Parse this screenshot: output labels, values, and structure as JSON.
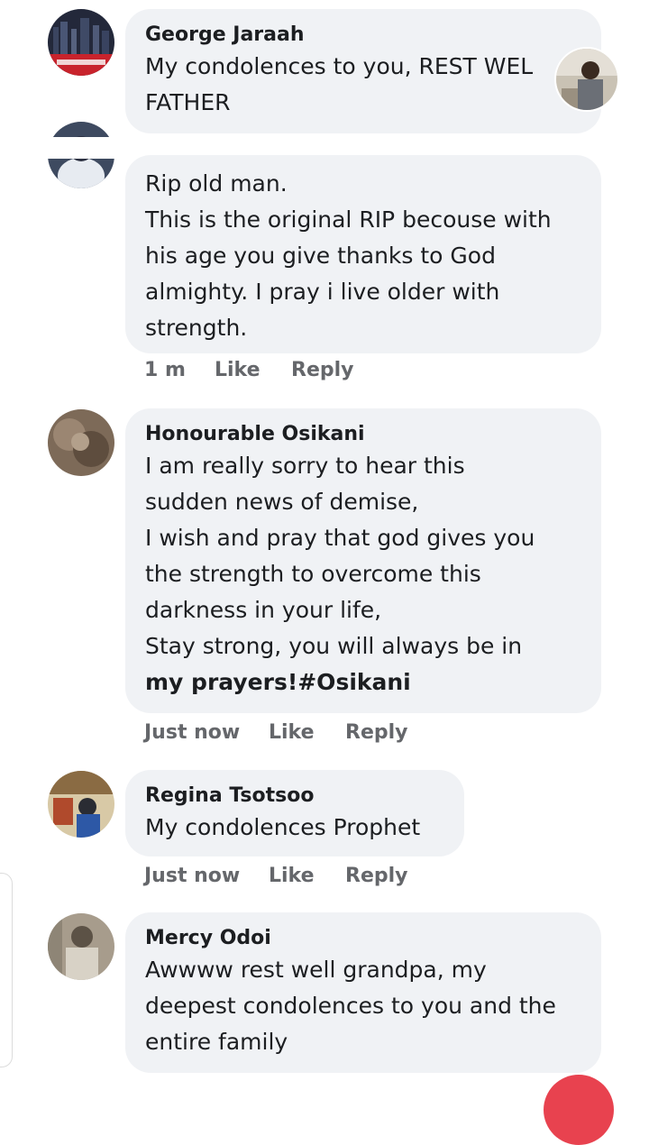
{
  "comments": [
    {
      "name": "George Jaraah",
      "lines": [
        "My condolences to you, REST WEL",
        "FATHER"
      ],
      "time": "",
      "like": "",
      "reply": ""
    },
    {
      "name": "",
      "lines": [
        "Rip old man.",
        "This is the original RIP becouse with",
        "his age you give thanks to God",
        "almighty. I pray i live older with",
        "strength."
      ],
      "time": "1 m",
      "like": "Like",
      "reply": "Reply"
    },
    {
      "name": "Honourable Osikani",
      "lines": [
        "I am really sorry to hear this",
        "sudden news of demise,",
        "I wish and pray that god gives you",
        "the strength to overcome this",
        "darkness in your life,",
        "Stay strong, you will always be in",
        "my prayers!#Osikani"
      ],
      "time": "Just now",
      "like": "Like",
      "reply": "Reply"
    },
    {
      "name": "Regina Tsotsoo",
      "lines": [
        "My condolences Prophet"
      ],
      "time": "Just now",
      "like": "Like",
      "reply": "Reply"
    },
    {
      "name": "Mercy Odoi",
      "lines": [
        "Awwww rest well grandpa, my",
        "deepest condolences to you and the",
        "entire family"
      ],
      "time": "",
      "like": "",
      "reply": ""
    }
  ],
  "colors": {
    "bubble": "#f0f2f5",
    "meta": "#65676b",
    "floating_button": "#e8424f"
  }
}
